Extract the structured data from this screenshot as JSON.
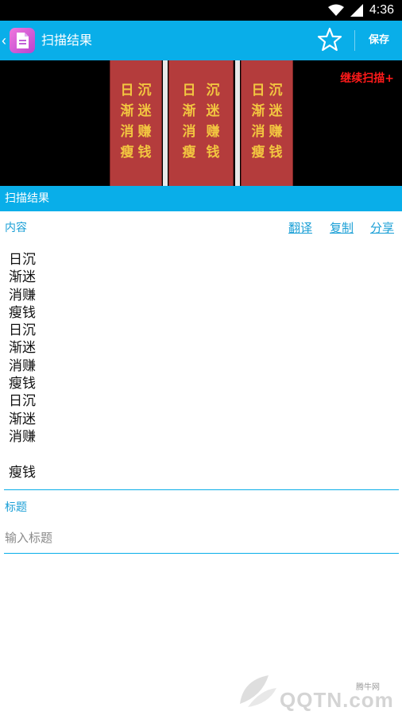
{
  "status_bar": {
    "time": "4:36"
  },
  "app_bar": {
    "title": "扫描结果",
    "save_label": "保存"
  },
  "preview": {
    "continue_label": "继续扫描+",
    "panels": [
      [
        "日",
        "沉",
        "渐",
        "迷",
        "消",
        "赚",
        "瘦",
        "钱"
      ],
      [
        "日",
        "沉",
        "渐",
        "迷",
        "消",
        "赚",
        "瘦",
        "钱"
      ],
      [
        "日",
        "沉",
        "渐",
        "迷",
        "消",
        "赚",
        "瘦",
        "钱"
      ]
    ]
  },
  "section_header": "扫描结果",
  "content": {
    "label": "内容",
    "actions": {
      "translate": "翻译",
      "copy": "复制",
      "share": "分享"
    },
    "text": "日沉\n渐迷\n消赚\n瘦钱\n日沉\n渐迷\n消赚\n瘦钱\n日沉\n渐迷\n消赚\n\n瘦钱"
  },
  "title_field": {
    "label": "标题",
    "placeholder": "输入标题",
    "value": ""
  },
  "watermark": {
    "small_text": "腾牛网",
    "brand_text": "QQTN.com"
  },
  "colors": {
    "accent": "#09aee9",
    "link": "#1a9fd6",
    "continue": "#ff1a1a",
    "panel_red": "#b43c3c",
    "glyph_gold": "#f2c640"
  }
}
